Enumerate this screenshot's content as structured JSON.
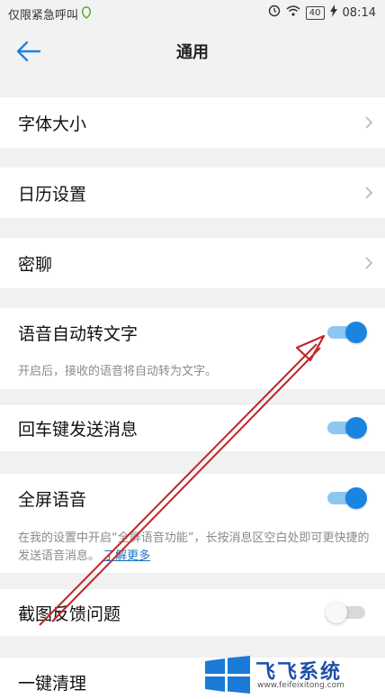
{
  "status_bar": {
    "carrier": "仅限紧急呼叫",
    "battery": "40",
    "time": "08:14"
  },
  "header": {
    "title": "通用",
    "back_icon": "back-arrow-icon"
  },
  "settings": {
    "font_size": "字体大小",
    "calendar": "日历设置",
    "secret_chat": "密聊",
    "voice_to_text": {
      "label": "语音自动转文字",
      "on": true
    },
    "voice_to_text_desc": "开启后，接收的语音将自动转为文字。",
    "enter_send": {
      "label": "回车键发送消息",
      "on": true
    },
    "fullscreen_voice": {
      "label": "全屏语音",
      "on": true
    },
    "fullscreen_voice_desc": "在我的设置中开启“全屏语音功能”，长按消息区空白处即可更快捷的发送语音消息。",
    "fullscreen_voice_link": "了解更多",
    "screenshot_feedback": {
      "label": "截图反馈问题",
      "on": false
    },
    "one_key_clean": "一键清理"
  },
  "watermark": {
    "brand": "飞飞系统",
    "url": "www.feifeixitong.com"
  },
  "colors": {
    "accent": "#1a85e0",
    "annotation_arrow": "#c0262b"
  }
}
